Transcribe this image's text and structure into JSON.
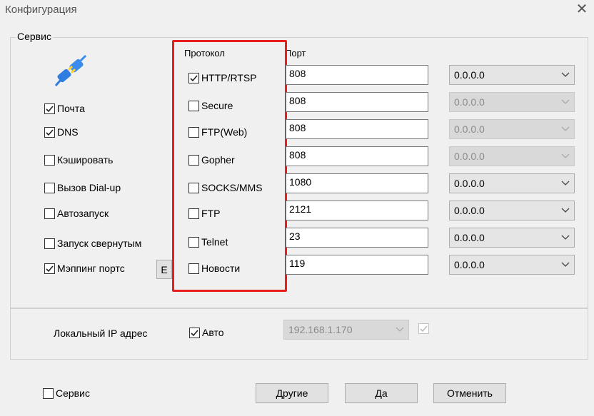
{
  "window": {
    "title": "Конфигурация"
  },
  "service_group": {
    "label": "Сервис",
    "options": [
      {
        "label": "Почта",
        "checked": true
      },
      {
        "label": "DNS",
        "checked": true
      },
      {
        "label": "Кэшировать",
        "checked": false
      },
      {
        "label": "Вызов Dial-up",
        "checked": false
      },
      {
        "label": "Автозапуск",
        "checked": false
      },
      {
        "label": "Запуск свернутым",
        "checked": false
      },
      {
        "label": "Мэппинг портс",
        "checked": true
      }
    ],
    "mapping_button_label": "E"
  },
  "table": {
    "protocol_header": "Протокол",
    "port_header": "Порт",
    "rows": [
      {
        "protocol": "HTTP/RTSP",
        "checked": true,
        "port": "808",
        "ip": "0.0.0.0",
        "ip_enabled": true
      },
      {
        "protocol": "Secure",
        "checked": false,
        "port": "808",
        "ip": "0.0.0.0",
        "ip_enabled": false
      },
      {
        "protocol": "FTP(Web)",
        "checked": false,
        "port": "808",
        "ip": "0.0.0.0",
        "ip_enabled": false
      },
      {
        "protocol": "Gopher",
        "checked": false,
        "port": "808",
        "ip": "0.0.0.0",
        "ip_enabled": false
      },
      {
        "protocol": "SOCKS/MMS",
        "checked": false,
        "port": "1080",
        "ip": "0.0.0.0",
        "ip_enabled": true
      },
      {
        "protocol": "FTP",
        "checked": false,
        "port": "2121",
        "ip": "0.0.0.0",
        "ip_enabled": true
      },
      {
        "protocol": "Telnet",
        "checked": false,
        "port": "23",
        "ip": "0.0.0.0",
        "ip_enabled": true
      },
      {
        "protocol": "Новости",
        "checked": false,
        "port": "119",
        "ip": "0.0.0.0",
        "ip_enabled": true
      }
    ]
  },
  "local_ip": {
    "label": "Локальный IP адрес",
    "auto_label": "Авто",
    "auto_checked": true,
    "ip_value": "192.168.1.170",
    "extra_checked": true
  },
  "footer": {
    "service_label": "Сервис",
    "service_checked": false,
    "other_button": "Другие",
    "ok_button": "Да",
    "cancel_button": "Отменить"
  },
  "colors": {
    "highlight_frame": "#e81e1e"
  },
  "icons": {
    "service": "plug-connector-icon",
    "close": "close-icon",
    "dropdown": "chevron-down-icon"
  }
}
